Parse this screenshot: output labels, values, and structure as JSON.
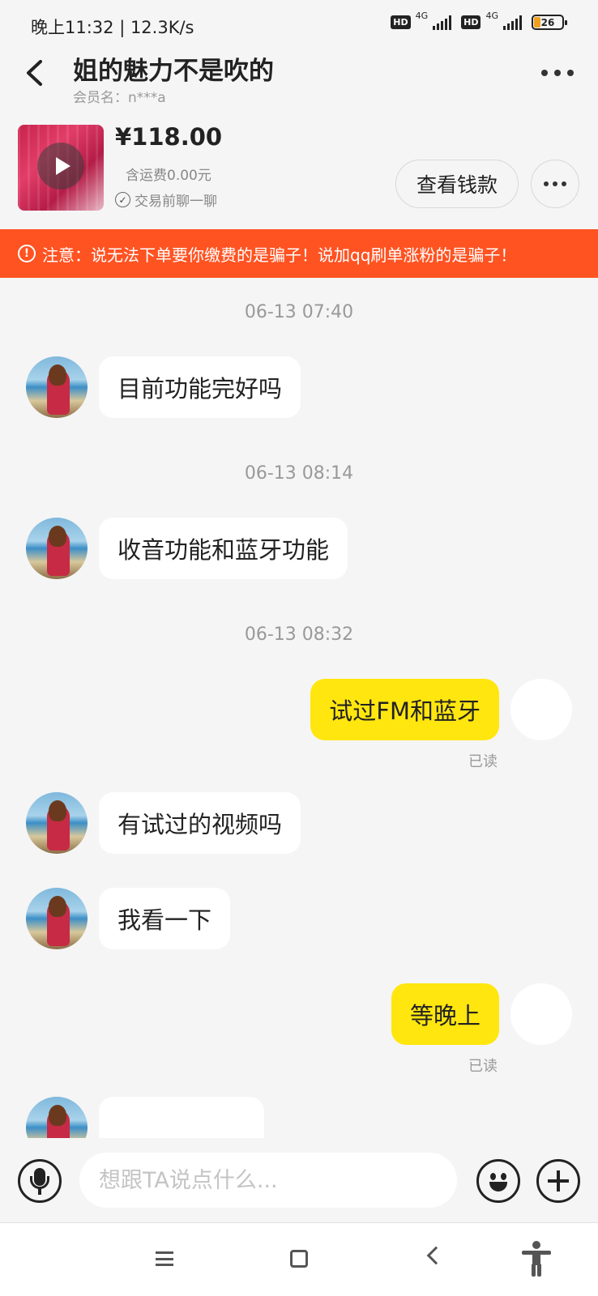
{
  "status_bar": {
    "time_speed": "晚上11:32 | 12.3K/s",
    "hd_label": "HD",
    "network_label": "4G",
    "battery_level": "26"
  },
  "header": {
    "title": "姐的魅力不是吹的",
    "member_label": "会员名：n***a"
  },
  "product": {
    "price": "¥118.00",
    "shipping": "含运费0.00元",
    "chat_before_trade": "交易前聊一聊",
    "view_money_button": "查看钱款"
  },
  "warning": {
    "text": "注意：说无法下单要你缴费的是骗子！说加qq刷单涨粉的是骗子！"
  },
  "chat": {
    "messages": [
      {
        "time": "06-13 07:40"
      },
      {
        "side": "in",
        "text": "目前功能完好吗"
      },
      {
        "time": "06-13 08:14"
      },
      {
        "side": "in",
        "text": "收音功能和蓝牙功能"
      },
      {
        "time": "06-13 08:32"
      },
      {
        "side": "out",
        "text": "试过FM和蓝牙",
        "status": "已读"
      },
      {
        "side": "in",
        "text": "有试过的视频吗"
      },
      {
        "side": "in",
        "text": "我看一下"
      },
      {
        "side": "out",
        "text": "等晚上",
        "status": "已读"
      }
    ]
  },
  "input": {
    "placeholder": "想跟TA说点什么..."
  },
  "icons": {
    "back": "chevron-left-icon",
    "more": "more-dots-icon",
    "play": "play-icon",
    "check": "check-circle-icon",
    "warning": "warning-icon",
    "mic": "microphone-icon",
    "emoji": "emoji-icon",
    "plus": "plus-icon"
  },
  "colors": {
    "warning_banner": "#ff5322",
    "outgoing_bubble": "#ffe60f",
    "incoming_bubble": "#ffffff",
    "background": "#f5f5f5"
  }
}
